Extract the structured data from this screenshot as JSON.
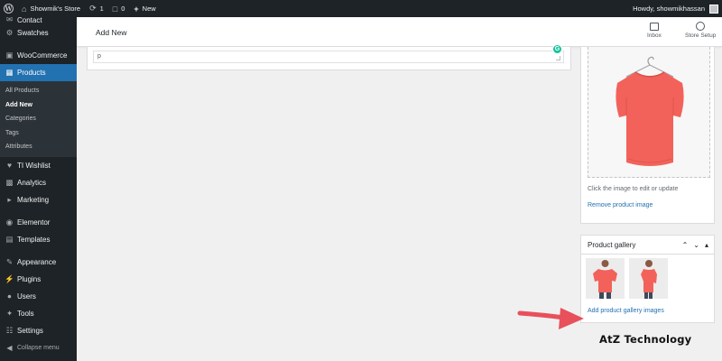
{
  "adminbar": {
    "site_name": "Showmik's Store",
    "updates_count": "1",
    "comments_count": "0",
    "new_label": "New",
    "howdy": "Howdy, showmikhassan"
  },
  "sidebar": {
    "items_top": [
      {
        "label": "Contact",
        "icon": "mail-icon"
      },
      {
        "label": "Swatches",
        "icon": "gear-icon"
      }
    ],
    "woocommerce": "WooCommerce",
    "products": "Products",
    "submenu": [
      "All Products",
      "Add New",
      "Categories",
      "Tags",
      "Attributes"
    ],
    "items_bottom": [
      {
        "label": "TI Wishlist",
        "icon": "heart-icon"
      },
      {
        "label": "Analytics",
        "icon": "bar-chart-icon"
      },
      {
        "label": "Marketing",
        "icon": "megaphone-icon"
      },
      {
        "label": "Elementor",
        "icon": "elementor-icon"
      },
      {
        "label": "Templates",
        "icon": "folder-icon"
      },
      {
        "label": "Appearance",
        "icon": "brush-icon"
      },
      {
        "label": "Plugins",
        "icon": "plug-icon"
      },
      {
        "label": "Users",
        "icon": "user-icon"
      },
      {
        "label": "Tools",
        "icon": "wrench-icon"
      },
      {
        "label": "Settings",
        "icon": "settings-icon"
      }
    ],
    "collapse": "Collapse menu"
  },
  "header": {
    "title": "Add New",
    "inbox": "Inbox",
    "store_setup": "Store Setup"
  },
  "editor": {
    "path_text": "p"
  },
  "product_image": {
    "caption": "Click the image to edit or update",
    "remove_link": "Remove product image"
  },
  "gallery": {
    "title": "Product gallery",
    "add_link": "Add product gallery images"
  },
  "watermark": "AtZ Technology",
  "colors": {
    "admin_bar": "#1d2327",
    "active_menu": "#2271b1",
    "shirt": "#f2625a",
    "arrow": "#e8505b"
  }
}
